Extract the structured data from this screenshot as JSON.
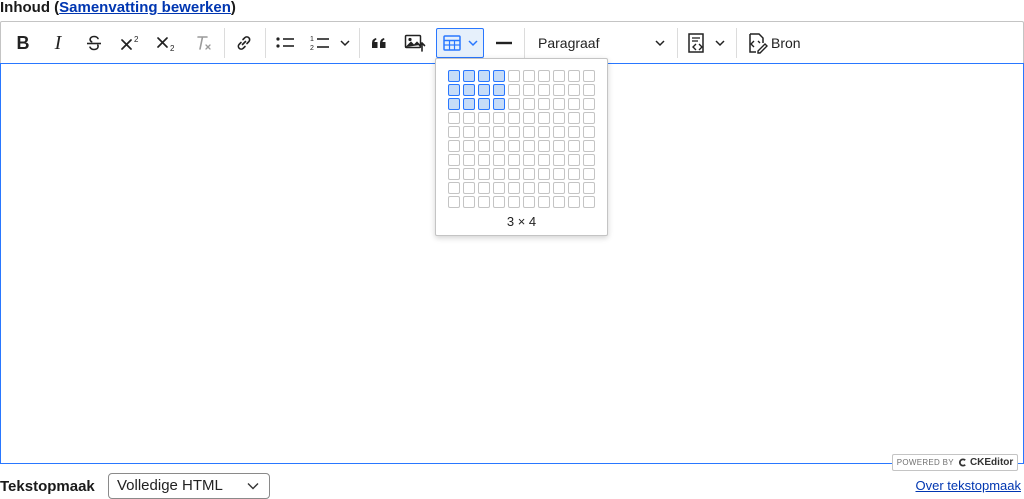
{
  "field": {
    "label": "Inhoud",
    "paren_open": " (",
    "summary_link": "Samenvatting bewerken",
    "paren_close": ")"
  },
  "toolbar": {
    "bold": "B",
    "italic": "I",
    "heading_select": "Paragraaf",
    "source_label": "Bron",
    "accent_color": "#2977ff"
  },
  "table_picker": {
    "rows_selected": 3,
    "cols_selected": 4,
    "size_label": "3 × 4"
  },
  "editor": {
    "powered_by": "POWERED BY",
    "brand": "CKEditor"
  },
  "text_format": {
    "label": "Tekstopmaak",
    "selected": "Volledige HTML",
    "help_link": "Over tekstopmaak"
  }
}
